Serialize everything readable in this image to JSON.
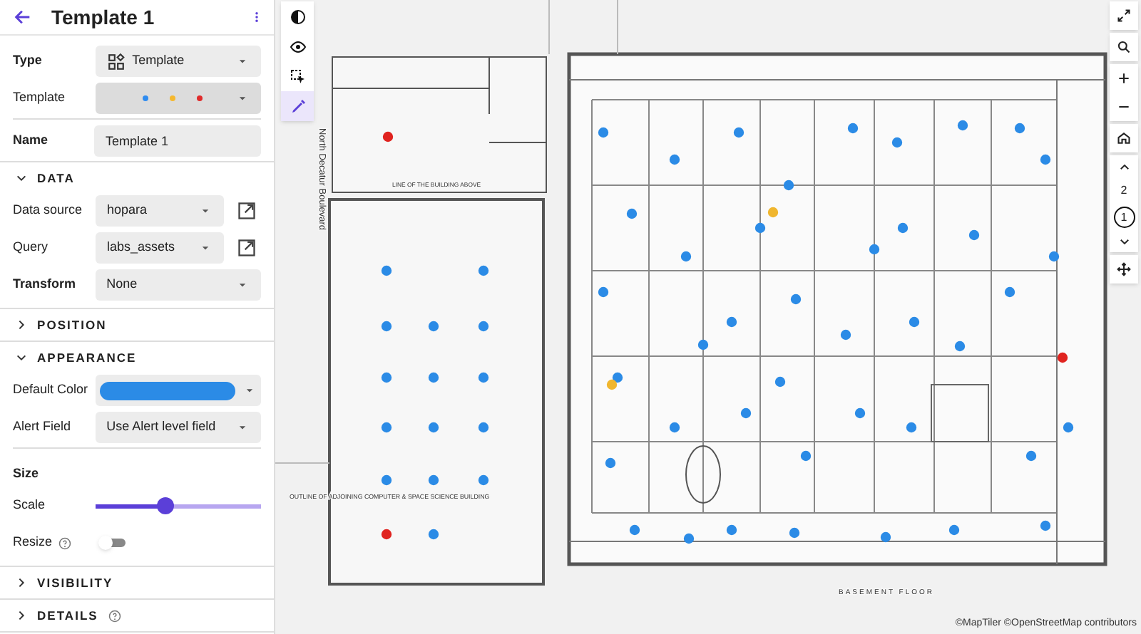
{
  "header": {
    "title": "Template 1"
  },
  "top_fields": [
    {
      "kind": "select_icon",
      "label": "Type",
      "value": "Template",
      "bold": true
    },
    {
      "kind": "swatches",
      "label": "Template",
      "swatches": [
        {
          "color": "#2f8cf0"
        },
        {
          "color": "#f5b82e"
        },
        {
          "color": "#e02b2b"
        }
      ]
    },
    {
      "kind": "text",
      "label": "Name",
      "value": "Template 1",
      "bold": true
    }
  ],
  "sections": [
    {
      "title": "DATA",
      "expanded": true,
      "fields": [
        {
          "kind": "select_link",
          "label": "Data source",
          "value": "hopara",
          "bold": false
        },
        {
          "kind": "select_link",
          "label": "Query",
          "value": "labs_assets",
          "bold": false
        },
        {
          "kind": "select",
          "label": "Transform",
          "value": "None",
          "bold": true
        }
      ]
    },
    {
      "title": "POSITION",
      "expanded": false
    },
    {
      "title": "APPEARANCE",
      "expanded": true,
      "fields": [
        {
          "kind": "color",
          "label": "Default Color",
          "color": "#2b8be6"
        },
        {
          "kind": "select",
          "label": "Alert Field",
          "value": "Use Alert level field",
          "bold": false
        },
        {
          "kind": "heading",
          "label": "Size"
        },
        {
          "kind": "slider",
          "label": "Scale",
          "level": 0.42
        },
        {
          "kind": "toggle",
          "label": "Resize",
          "on": false,
          "help": true
        }
      ]
    },
    {
      "title": "VISIBILITY",
      "expanded": false
    },
    {
      "title": "DETAILS",
      "expanded": false,
      "help": true
    }
  ],
  "map_tools": [
    {
      "kind": "contrast",
      "selected": false
    },
    {
      "kind": "eye",
      "selected": false
    },
    {
      "kind": "select",
      "selected": false
    },
    {
      "kind": "pen",
      "selected": true
    }
  ],
  "floors": [
    {
      "label": "2",
      "selected": false
    },
    {
      "label": "1",
      "selected": true
    }
  ],
  "map_labels": {
    "street": "North Decatur Boulevard",
    "building_line": "LINE OF THE BUILDING ABOVE",
    "outline": "OUTLINE OF ADJOINING COMPUTER & SPACE SCIENCE BUILDING",
    "floor": "BASEMENT FLOOR"
  },
  "attribution": "©MapTiler ©OpenStreetMap contributors"
}
